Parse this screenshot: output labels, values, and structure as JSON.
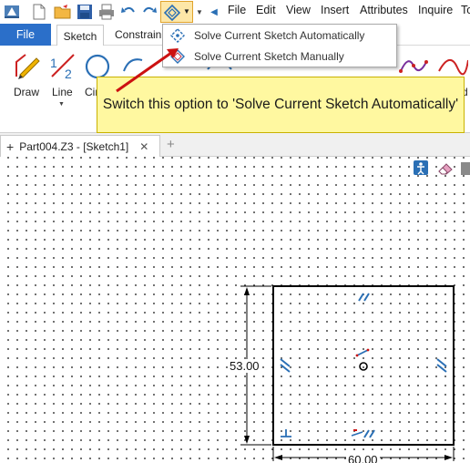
{
  "menu": {
    "file": "File",
    "edit": "Edit",
    "view": "View",
    "insert": "Insert",
    "attributes": "Attributes",
    "inquire": "Inquire",
    "overflow": "To"
  },
  "ribbon_tabs": {
    "file": "File",
    "sketch": "Sketch",
    "constraints": "Constrain"
  },
  "tools": {
    "draw": "Draw",
    "line": "Line",
    "circle": "Cir",
    "right_partial": "d"
  },
  "solve_menu": {
    "items": [
      {
        "label": "Solve Current Sketch Automatically"
      },
      {
        "label": "Solve Current Sketch Manually"
      }
    ]
  },
  "callout": {
    "text": "Switch this option to 'Solve Current Sketch Automatically'"
  },
  "doc_tab": {
    "title": "Part004.Z3 - [Sketch1]",
    "close_glyph": "✕",
    "add_glyph": "+"
  },
  "sketch": {
    "height_dim": "53.00",
    "width_dim": "60.00"
  },
  "colors": {
    "file_tab": "#2b6fc9",
    "callout_bg": "#fff8a0",
    "arrow": "#cc1111",
    "sketch_icon_blue": "#2a6fb5",
    "geometry": "#000000"
  }
}
